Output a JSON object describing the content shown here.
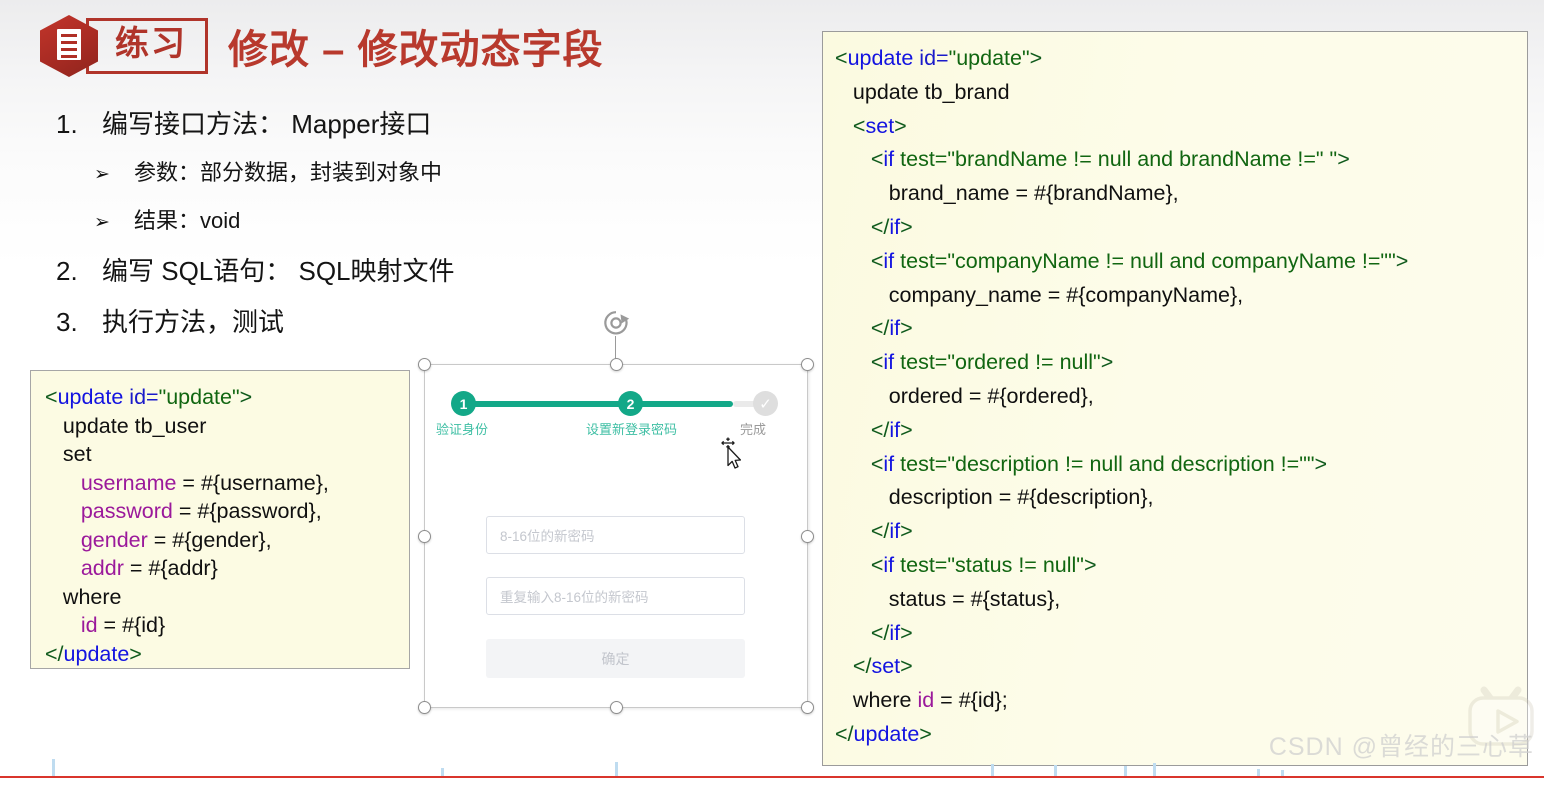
{
  "slide": {
    "badge": {
      "icon": "document-icon",
      "label": "练习"
    },
    "title": "修改 – 修改动态字段"
  },
  "bullets": [
    {
      "marker": "1.",
      "text": "编写接口方法： Mapper接口",
      "level": 1
    },
    {
      "marker": "➢",
      "text": "参数：部分数据，封装到对象中",
      "level": 2
    },
    {
      "marker": "➢",
      "text": "结果：void",
      "level": 2
    },
    {
      "marker": "2.",
      "text": "编写 SQL语句： SQL映射文件",
      "level": 1
    },
    {
      "marker": "3.",
      "text": "执行方法，测试",
      "level": 1
    }
  ],
  "code_left": {
    "title": "tb_user static update mapper",
    "lines": [
      [
        {
          "t": "<",
          "c": "angle"
        },
        {
          "t": "update ",
          "c": "tag"
        },
        {
          "t": "id=",
          "c": "attr"
        },
        {
          "t": "\"update\"",
          "c": "str"
        },
        {
          "t": ">",
          "c": "angle"
        }
      ],
      [
        {
          "t": "   update tb_user",
          "c": "plain"
        }
      ],
      [
        {
          "t": "   set",
          "c": "plain"
        }
      ],
      [
        {
          "t": "      ",
          "c": "plain"
        },
        {
          "t": "username",
          "c": "field"
        },
        {
          "t": " = #{username},",
          "c": "plain"
        }
      ],
      [
        {
          "t": "      ",
          "c": "plain"
        },
        {
          "t": "password",
          "c": "field"
        },
        {
          "t": " = #{password},",
          "c": "plain"
        }
      ],
      [
        {
          "t": "      ",
          "c": "plain"
        },
        {
          "t": "gender",
          "c": "field"
        },
        {
          "t": " = #{gender},",
          "c": "plain"
        }
      ],
      [
        {
          "t": "      ",
          "c": "plain"
        },
        {
          "t": "addr",
          "c": "field"
        },
        {
          "t": " = #{addr}",
          "c": "plain"
        }
      ],
      [
        {
          "t": "   where",
          "c": "plain"
        }
      ],
      [
        {
          "t": "      ",
          "c": "plain"
        },
        {
          "t": "id",
          "c": "field"
        },
        {
          "t": " = #{id}",
          "c": "plain"
        }
      ],
      [
        {
          "t": "</",
          "c": "angle"
        },
        {
          "t": "update",
          "c": "tag"
        },
        {
          "t": ">",
          "c": "angle"
        }
      ]
    ]
  },
  "code_right": {
    "title": "tb_brand dynamic set update mapper",
    "lines": [
      [
        {
          "t": "<",
          "c": "angle"
        },
        {
          "t": "update ",
          "c": "tag"
        },
        {
          "t": "id=",
          "c": "attr"
        },
        {
          "t": "\"update\"",
          "c": "str"
        },
        {
          "t": ">",
          "c": "angle"
        }
      ],
      [
        {
          "t": "   update tb_brand",
          "c": "plain"
        }
      ],
      [
        {
          "t": "   <",
          "c": "angle"
        },
        {
          "t": "set",
          "c": "tag"
        },
        {
          "t": ">",
          "c": "angle"
        }
      ],
      [
        {
          "t": "      <",
          "c": "angle"
        },
        {
          "t": "if ",
          "c": "tag"
        },
        {
          "t": "test=",
          "c": "str"
        },
        {
          "t": "\"brandName != null and brandName !=\" \"",
          "c": "str"
        },
        {
          "t": ">",
          "c": "angle"
        }
      ],
      [
        {
          "t": "         brand_name = #{brandName},",
          "c": "plain"
        }
      ],
      [
        {
          "t": "      </",
          "c": "angle"
        },
        {
          "t": "if",
          "c": "tag"
        },
        {
          "t": ">",
          "c": "angle"
        }
      ],
      [
        {
          "t": "      <",
          "c": "angle"
        },
        {
          "t": "if ",
          "c": "tag"
        },
        {
          "t": "test=",
          "c": "str"
        },
        {
          "t": "\"companyName != null and companyName !=\"\"",
          "c": "str"
        },
        {
          "t": ">",
          "c": "angle"
        }
      ],
      [
        {
          "t": "         company_name = #{companyName},",
          "c": "plain"
        }
      ],
      [
        {
          "t": "      </",
          "c": "angle"
        },
        {
          "t": "if",
          "c": "tag"
        },
        {
          "t": ">",
          "c": "angle"
        }
      ],
      [
        {
          "t": "      <",
          "c": "angle"
        },
        {
          "t": "if ",
          "c": "tag"
        },
        {
          "t": "test=",
          "c": "str"
        },
        {
          "t": "\"ordered != null\"",
          "c": "str"
        },
        {
          "t": ">",
          "c": "angle"
        }
      ],
      [
        {
          "t": "         ordered = #{ordered},",
          "c": "plain"
        }
      ],
      [
        {
          "t": "      </",
          "c": "angle"
        },
        {
          "t": "if",
          "c": "tag"
        },
        {
          "t": ">",
          "c": "angle"
        }
      ],
      [
        {
          "t": "      <",
          "c": "angle"
        },
        {
          "t": "if ",
          "c": "tag"
        },
        {
          "t": "test=",
          "c": "str"
        },
        {
          "t": "\"description != null and description !=\"\"",
          "c": "str"
        },
        {
          "t": ">",
          "c": "angle"
        }
      ],
      [
        {
          "t": "         description = #{description},",
          "c": "plain"
        }
      ],
      [
        {
          "t": "      </",
          "c": "angle"
        },
        {
          "t": "if",
          "c": "tag"
        },
        {
          "t": ">",
          "c": "angle"
        }
      ],
      [
        {
          "t": "      <",
          "c": "angle"
        },
        {
          "t": "if ",
          "c": "tag"
        },
        {
          "t": "test=",
          "c": "str"
        },
        {
          "t": "\"status != null\"",
          "c": "str"
        },
        {
          "t": ">",
          "c": "angle"
        }
      ],
      [
        {
          "t": "         status = #{status},",
          "c": "plain"
        }
      ],
      [
        {
          "t": "      </",
          "c": "angle"
        },
        {
          "t": "if",
          "c": "tag"
        },
        {
          "t": ">",
          "c": "angle"
        }
      ],
      [
        {
          "t": "   </",
          "c": "angle"
        },
        {
          "t": "set",
          "c": "tag"
        },
        {
          "t": ">",
          "c": "angle"
        }
      ],
      [
        {
          "t": "   where ",
          "c": "plain"
        },
        {
          "t": "id",
          "c": "field"
        },
        {
          "t": " = #{id};",
          "c": "plain"
        }
      ],
      [
        {
          "t": "</",
          "c": "angle"
        },
        {
          "t": "update",
          "c": "tag"
        },
        {
          "t": ">",
          "c": "angle"
        }
      ]
    ]
  },
  "picture": {
    "steps": [
      {
        "number": "1",
        "label": "验证身份",
        "state": "active"
      },
      {
        "number": "2",
        "label": "设置新登录密码",
        "state": "active"
      },
      {
        "number": "✓",
        "label": "完成",
        "state": "idle"
      }
    ],
    "password_input": {
      "placeholder": "8-16位的新密码",
      "value": ""
    },
    "password_confirm_input": {
      "placeholder": "重复输入8-16位的新密码",
      "value": ""
    },
    "confirm_button": "确定"
  },
  "watermark": {
    "csdn": "CSDN @曾经的三心草",
    "bilibili_icon": "bilibili-tv-icon"
  },
  "colors": {
    "brand_red": "#b8392d",
    "badge_red": "#b0342a",
    "code_bg": "#fcfbe3",
    "teal": "#13a888",
    "teal_label": "#3fbfa4",
    "tag_blue": "#1313e0",
    "string_green": "#116611",
    "field_purple": "#9b199b",
    "bottom_rule": "#d9352c"
  }
}
